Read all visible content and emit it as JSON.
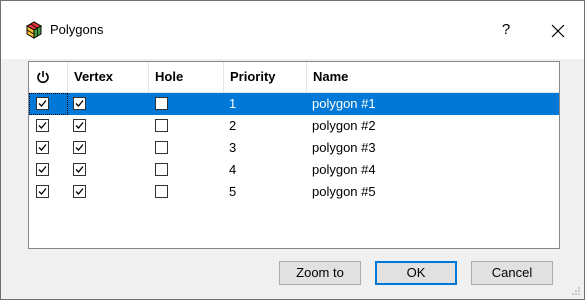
{
  "window": {
    "title": "Polygons",
    "help_label": "?",
    "close_label": "✕",
    "app_icon": "cube-icon"
  },
  "table": {
    "columns": {
      "enabled_icon": "power-icon",
      "vertex": "Vertex",
      "hole": "Hole",
      "priority": "Priority",
      "name": "Name"
    },
    "rows": [
      {
        "enabled": true,
        "vertex": true,
        "hole": false,
        "priority": "1",
        "name": "polygon #1",
        "selected": true
      },
      {
        "enabled": true,
        "vertex": true,
        "hole": false,
        "priority": "2",
        "name": "polygon #2",
        "selected": false
      },
      {
        "enabled": true,
        "vertex": true,
        "hole": false,
        "priority": "3",
        "name": "polygon #3",
        "selected": false
      },
      {
        "enabled": true,
        "vertex": true,
        "hole": false,
        "priority": "4",
        "name": "polygon #4",
        "selected": false
      },
      {
        "enabled": true,
        "vertex": true,
        "hole": false,
        "priority": "5",
        "name": "polygon #5",
        "selected": false
      }
    ]
  },
  "buttons": {
    "zoom_to": "Zoom to",
    "ok": "OK",
    "cancel": "Cancel"
  },
  "colors": {
    "selection": "#0078d7",
    "default_button_border": "#0078d7"
  }
}
